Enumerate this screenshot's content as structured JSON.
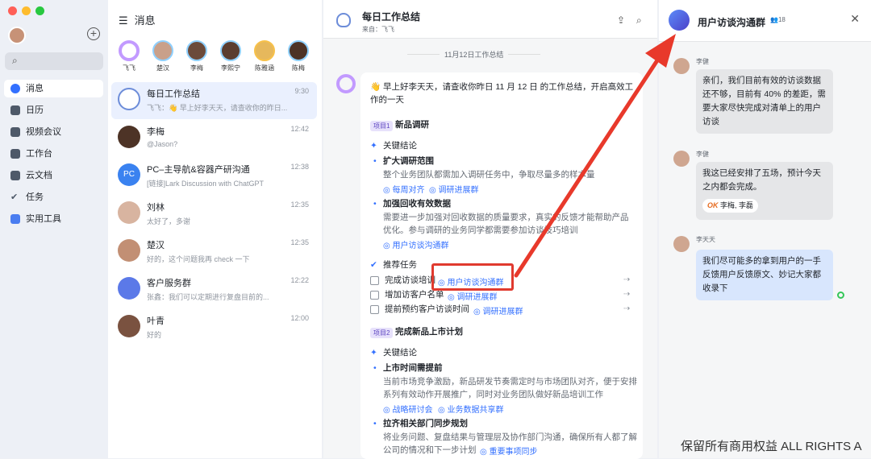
{
  "sidebar": {
    "search_placeholder": "Q",
    "items": [
      {
        "label": "消息",
        "active": true
      },
      {
        "label": "日历"
      },
      {
        "label": "视频会议"
      },
      {
        "label": "工作台"
      },
      {
        "label": "云文档"
      },
      {
        "label": "任务"
      },
      {
        "label": "实用工具"
      }
    ]
  },
  "list": {
    "title": "消息",
    "stories": [
      "飞飞",
      "楚汉",
      "李梅",
      "李熙宁",
      "陈雅涵",
      "陈梅"
    ],
    "convos": [
      {
        "name": "每日工作总结",
        "preview": "飞飞：👋 早上好李天天，请查收你的昨日...",
        "time": "9:30"
      },
      {
        "name": "李梅",
        "preview": "@Jason?",
        "time": "12:42"
      },
      {
        "name": "PC–主导航&容器产研沟通",
        "preview": "[链接]Lark Discussion with ChatGPT",
        "time": "12:38"
      },
      {
        "name": "刘林",
        "preview": "太好了，多谢",
        "time": "12:35"
      },
      {
        "name": "楚汉",
        "preview": "好的，这个问题我再 check 一下",
        "time": "12:35"
      },
      {
        "name": "客户服务群",
        "preview": "张鑫：我们可以定期进行复盘目前的...",
        "time": "12:22"
      },
      {
        "name": "叶青",
        "preview": "好的",
        "time": "12:00"
      }
    ]
  },
  "chat": {
    "title": "每日工作总结",
    "from": "来自：飞飞",
    "date_sep": "11月12日工作总结",
    "greeting": "👋 早上好李天天，请查收你昨日 11 月 12 日 的工作总结，开启高效工作的一天",
    "p1_tag": "项目1",
    "p1_title": "新品调研",
    "key_label": "关键结论",
    "b1_title": "扩大调研范围",
    "b1_text": "整个业务团队都需加入调研任务中，争取尽量多的样本量",
    "b1_links": [
      "每周对齐",
      "调研进展群"
    ],
    "b2_title": "加强回收有效数据",
    "b2_text1": "需要进一步加强对回收数据的质量要求，真实的反馈才能帮助产品",
    "b2_text2": "优化。参与调研的业务同学都需要参加访谈技巧培训",
    "b2_link": "用户访谈沟通群",
    "tasks_label": "推荐任务",
    "tasks": [
      {
        "text": "完成访谈培训",
        "link": "用户访谈沟通群"
      },
      {
        "text": "增加访客户名单",
        "link": "调研进展群"
      },
      {
        "text": "提前预约客户访谈时间",
        "link": "调研进展群"
      }
    ],
    "p2_tag": "项目2",
    "p2_title": "完成新品上市计划",
    "c1_title": "上市时间需提前",
    "c1_text1": "当前市场竞争激励，新品研发节奏需定时与市场团队对齐，便于安排",
    "c1_text2": "系列有效动作开展推广，同时对业务团队做好新品培训工作",
    "c1_links": [
      "战略研讨会",
      "业务数据共享群"
    ],
    "c2_title": "拉齐相关部门同步规划",
    "c2_text1": "将业务问题、复盘结果与管理层及协作部门沟通，确保所有人都了解",
    "c2_text2": "公司的情况和下一步计划",
    "c2_link": "重要事项同步"
  },
  "right": {
    "title": "用户访谈沟通群",
    "count": "18",
    "messages": [
      {
        "name": "李健",
        "text": "亲们，我们目前有效的访谈数据还不够，目前有 40% 的差距，需要大家尽快完成对清单上的用户访谈"
      },
      {
        "name": "李健",
        "text": "我这已经安排了五场，预计今天之内都会完成。",
        "reaction": "OK",
        "react_users": "李梅, 李磊"
      },
      {
        "name": "李天天",
        "text": "我们尽可能多的拿到用户的一手反馈用户反馈原文、妙记大家都收录下"
      }
    ]
  },
  "watermark": "保留所有商用权益  ALL RIGHTS A",
  "colors": {
    "accent": "#3370ff",
    "highlight": "#e03a2f",
    "arrow": "#e8392b"
  }
}
